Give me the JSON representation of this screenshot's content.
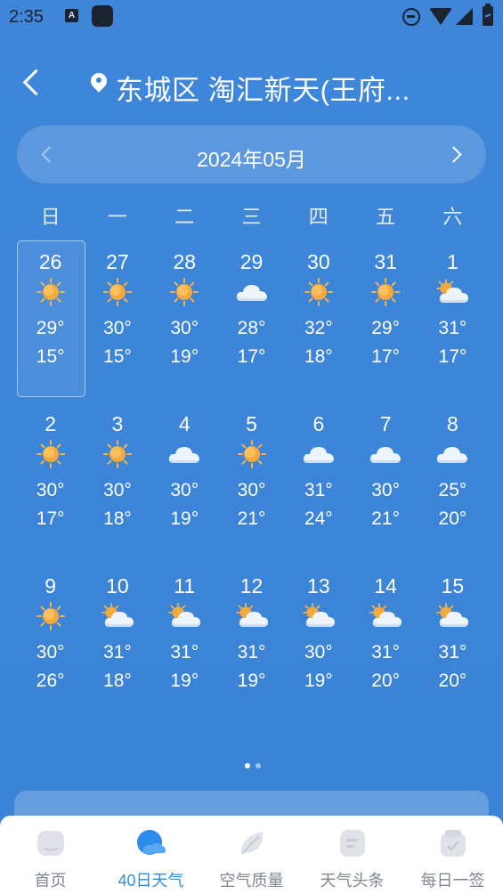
{
  "status_bar": {
    "time": "2:35",
    "app_a_icon_label": "A"
  },
  "header": {
    "location": "东城区 淘汇新天(王府..."
  },
  "month_bar": {
    "label": "2024年05月"
  },
  "weekdays": [
    "日",
    "一",
    "二",
    "三",
    "四",
    "五",
    "六"
  ],
  "days": [
    {
      "day": "26",
      "icon": "sunny",
      "high": "29°",
      "low": "15°",
      "selected": true
    },
    {
      "day": "27",
      "icon": "sunny",
      "high": "30°",
      "low": "15°"
    },
    {
      "day": "28",
      "icon": "sunny",
      "high": "30°",
      "low": "19°"
    },
    {
      "day": "29",
      "icon": "cloudy",
      "high": "28°",
      "low": "17°"
    },
    {
      "day": "30",
      "icon": "sunny",
      "high": "32°",
      "low": "18°"
    },
    {
      "day": "31",
      "icon": "sunny",
      "high": "29°",
      "low": "17°"
    },
    {
      "day": "1",
      "icon": "partly-cloudy",
      "high": "31°",
      "low": "17°"
    },
    {
      "day": "2",
      "icon": "sunny",
      "high": "30°",
      "low": "17°"
    },
    {
      "day": "3",
      "icon": "sunny",
      "high": "30°",
      "low": "18°"
    },
    {
      "day": "4",
      "icon": "cloudy",
      "high": "30°",
      "low": "19°"
    },
    {
      "day": "5",
      "icon": "sunny",
      "high": "30°",
      "low": "21°"
    },
    {
      "day": "6",
      "icon": "cloudy",
      "high": "31°",
      "low": "24°"
    },
    {
      "day": "7",
      "icon": "cloudy",
      "high": "30°",
      "low": "21°"
    },
    {
      "day": "8",
      "icon": "cloudy",
      "high": "25°",
      "low": "20°"
    },
    {
      "day": "9",
      "icon": "sunny",
      "high": "30°",
      "low": "26°"
    },
    {
      "day": "10",
      "icon": "partly-cloudy",
      "high": "31°",
      "low": "18°"
    },
    {
      "day": "11",
      "icon": "partly-cloudy",
      "high": "31°",
      "low": "19°"
    },
    {
      "day": "12",
      "icon": "partly-cloudy",
      "high": "31°",
      "low": "19°"
    },
    {
      "day": "13",
      "icon": "partly-cloudy",
      "high": "30°",
      "low": "19°"
    },
    {
      "day": "14",
      "icon": "partly-cloudy",
      "high": "31°",
      "low": "20°"
    },
    {
      "day": "15",
      "icon": "partly-cloudy",
      "high": "31°",
      "low": "20°"
    }
  ],
  "pagination": {
    "pages": 2,
    "active": 1
  },
  "bottom_nav": [
    {
      "label": "首页",
      "icon": "home-icon",
      "active": false
    },
    {
      "label": "40日天气",
      "icon": "forecast-40-day-icon",
      "active": true
    },
    {
      "label": "空气质量",
      "icon": "leaf-icon",
      "active": false
    },
    {
      "label": "天气头条",
      "icon": "news-icon",
      "active": false
    },
    {
      "label": "每日一签",
      "icon": "daily-sign-icon",
      "active": false
    }
  ],
  "colors": {
    "background": "#3f86d9",
    "nav_active": "#2d8bea",
    "nav_inactive": "#7f8792",
    "sun": "#f6a93b"
  }
}
